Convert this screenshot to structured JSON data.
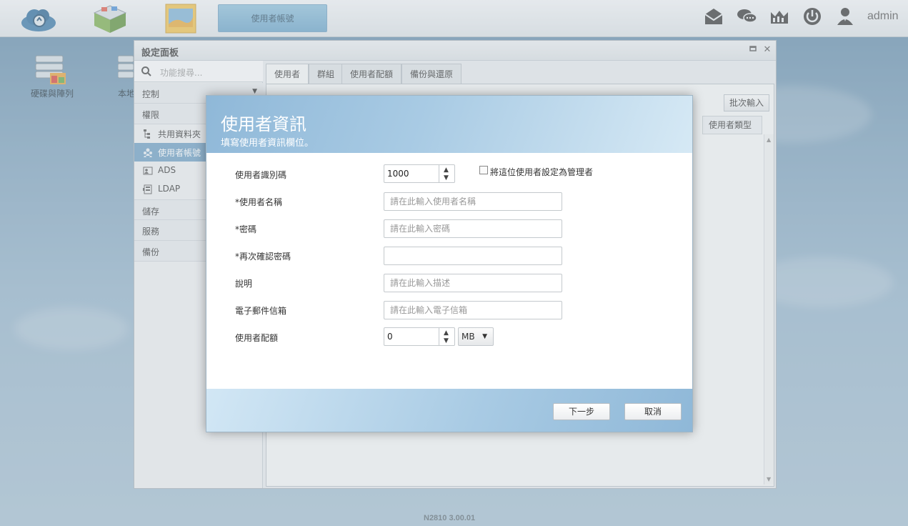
{
  "taskbar": {
    "active_tab": "使用者帳號",
    "user": "admin"
  },
  "desktop": {
    "icons": [
      "硬碟與陣列",
      "本地"
    ]
  },
  "window": {
    "title": "設定面板",
    "search_placeholder": "功能搜尋...",
    "sections": {
      "control": "控制",
      "permission": "權限",
      "storage": "儲存",
      "service": "服務",
      "backup": "備份"
    },
    "sub_items": {
      "shared_folder": "共用資料夾",
      "user_account": "使用者帳號",
      "ads": "ADS",
      "ldap": "LDAP"
    },
    "tabs": [
      "使用者",
      "群組",
      "使用者配額",
      "備份與還原"
    ],
    "batch_button": "批次輸入",
    "column_user_type": "使用者類型"
  },
  "modal": {
    "title": "使用者資訊",
    "subtitle": "填寫使用者資訊欄位。",
    "fields": {
      "uid_label": "使用者識別碼",
      "uid_value": "1000",
      "admin_checkbox_label": "將這位使用者設定為管理者",
      "username_label": "*使用者名稱",
      "username_placeholder": "請在此輸入使用者名稱",
      "password_label": "*密碼",
      "password_placeholder": "請在此輸入密碼",
      "confirm_label": "*再次確認密碼",
      "desc_label": "說明",
      "desc_placeholder": "請在此輸入描述",
      "email_label": "電子郵件信箱",
      "email_placeholder": "請在此輸入電子信箱",
      "quota_label": "使用者配額",
      "quota_value": "0",
      "quota_unit": "MB"
    },
    "next_button": "下一步",
    "cancel_button": "取消"
  },
  "footer": {
    "version": "N2810   3.00.01"
  },
  "colors": {
    "accent": "#6e9fc4",
    "modal_header": "#a9cbe4"
  }
}
